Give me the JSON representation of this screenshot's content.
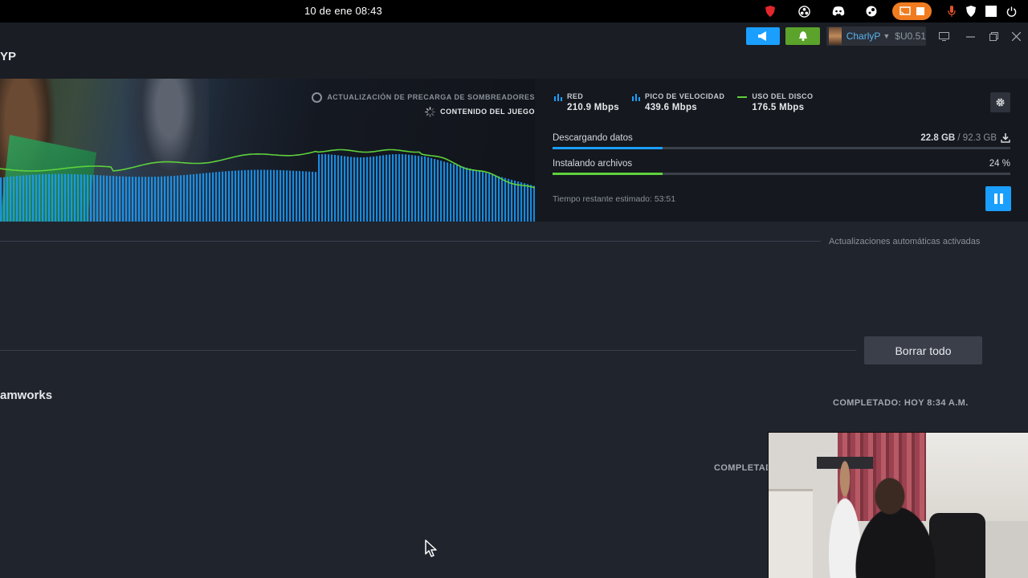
{
  "os_bar": {
    "clock": "10 de ene  08:43",
    "tray_icons": [
      "shield-red-icon",
      "obs-icon",
      "discord-icon",
      "steam-icon",
      "screencast-icon",
      "stop-icon",
      "microphone-icon",
      "vpn-shield-icon",
      "window-icon",
      "power-icon"
    ]
  },
  "window": {
    "title_fragment": "YP",
    "account": {
      "name": "CharlyP",
      "balance": "$U0.51"
    },
    "buttons": {
      "announcements": "megaphone-icon",
      "notifications": "bell-icon"
    },
    "controls": [
      "big-picture-icon",
      "minimize-icon",
      "maximize-icon",
      "close-icon"
    ]
  },
  "download": {
    "legend": {
      "shader": "ACTUALIZACIÓN DE PRECARGA DE SOMBREADORES",
      "content": "CONTENIDO DEL JUEGO"
    },
    "stats": [
      {
        "label": "RED",
        "value": "210.9 Mbps"
      },
      {
        "label": "PICO DE VELOCIDAD",
        "value": "439.6 Mbps"
      },
      {
        "label": "USO DEL DISCO",
        "value": "176.5 Mbps"
      }
    ],
    "downloading_label": "Descargando datos",
    "downloaded": "22.8 GB",
    "total_separator": " / ",
    "total": "92.3 GB",
    "download_progress": 0.24,
    "installing_label": "Instalando archivos",
    "install_percent": "24 %",
    "install_progress": 0.24,
    "eta": "Tiempo restante estimado: 53:51",
    "colors": {
      "network": "#1a9fff",
      "disk": "#5ed13c"
    }
  },
  "content": {
    "auto_updates": "Actualizaciones automáticas activadas",
    "clear_all": "Borrar todo",
    "game_name": "amworks",
    "completed_1": "COMPLETADO: HOY 8:34 A.M.",
    "completed_2": "COMPLETAD"
  }
}
